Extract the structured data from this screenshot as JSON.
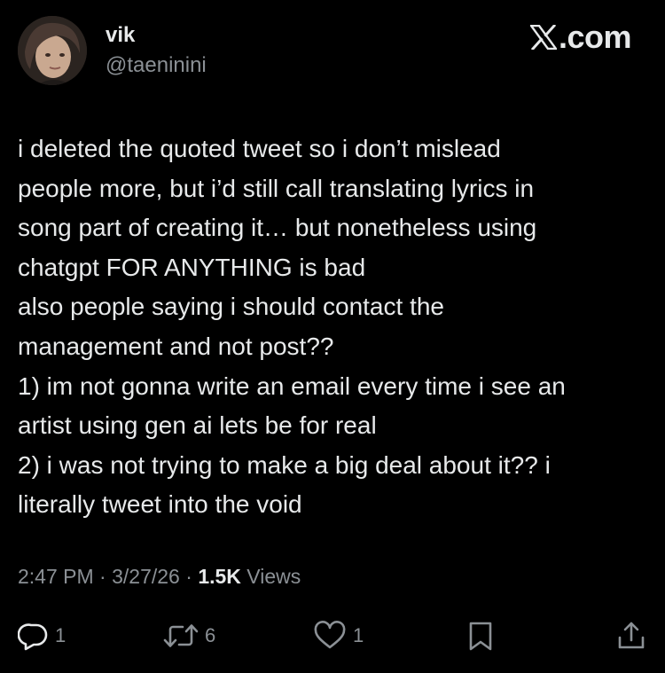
{
  "author": {
    "display_name": "vik",
    "handle": "@taeninini"
  },
  "brand": {
    "label": ".com",
    "icon": "x-logo-icon"
  },
  "tweet": {
    "lines": [
      "i deleted the quoted tweet so i don’t mislead",
      "people more, but i’d still call translating lyrics in",
      "song part of creating it… but nonetheless using",
      "chatgpt FOR ANYTHING is bad",
      "also people saying i should contact the",
      "management and not post??",
      "1) im not gonna write an email every time i see an",
      "artist using gen ai lets be for real",
      "2) i was not trying to make a big deal about it?? i",
      "literally tweet into the void"
    ]
  },
  "meta": {
    "time": "2:47 PM",
    "separator": "·",
    "date": "3/27/26",
    "views_count": "1.5K",
    "views_label": "Views"
  },
  "actions": {
    "reply_count": "1",
    "repost_count": "6",
    "like_count": "1"
  },
  "colors": {
    "background": "#000000",
    "primary_text": "#e7e9ea",
    "secondary_text": "#8b9095"
  }
}
